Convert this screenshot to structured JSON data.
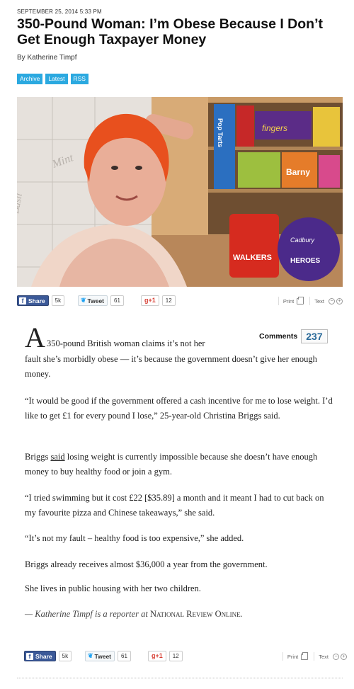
{
  "article": {
    "dateline": "SEPTEMBER 25, 2014 5:33 PM",
    "headline_line1": "350-Pound Woman: I’m Obese Because I Don’t",
    "headline_line2": "Get Enough Taxpayer Money",
    "byline": "By Katherine Timpf",
    "tags": [
      "Archive",
      "Latest",
      "RSS"
    ],
    "dropcap": "A",
    "p1_first_line": "350-pound British woman claims it’s not her",
    "p1_rest": "fault she’s morbidly obese — it’s because the government doesn’t give her enough money.",
    "p2": "“It would be good if the government offered a cash incentive for me to lose weight. I’d like to get £1  for every pound I lose,” 25-year-old Christina Briggs said.",
    "p3_link": "said",
    "p3_before": "Briggs ",
    "p3_after": " losing weight is currently impossible because she doesn’t have enough money to buy healthy food or join a gym.",
    "p4": "“I tried swimming but it cost £22 [$35.89] a month and it meant I had to cut back on my favourite pizza and Chinese takeaways,” she said.",
    "p5": "“It’s not my fault – healthy food is too expensive,” she added.",
    "p6": "Briggs already receives almost $36,000 a year from the government.",
    "p7": "She lives in public housing with her two children.",
    "signoff_prefix": "— Katherine Timpf is a reporter at ",
    "signoff_pub": "National Review Online",
    "signoff_end": "."
  },
  "photo": {
    "text_mint": "Mint",
    "text_basil": "Basil",
    "snack_labels": [
      "Pop Tarts",
      "fingers",
      "Barny",
      "WALKERS",
      "HEROES",
      "Cadbury"
    ]
  },
  "share_top": {
    "facebook_label": "Share",
    "facebook_count": "5k",
    "twitter_label": "Tweet",
    "twitter_count": "61",
    "gplus_label": "g+1",
    "gplus_count": "12",
    "print_label": "Print",
    "text_label": "Text"
  },
  "share_bottom": {
    "facebook_label": "Share",
    "facebook_count": "5k",
    "twitter_label": "Tweet",
    "twitter_count": "61",
    "gplus_label": "g+1",
    "gplus_count": "12",
    "print_label": "Print",
    "text_label": "Text"
  },
  "comments": {
    "label": "Comments",
    "count": "237"
  },
  "colors": {
    "tag_blue": "#2ba9e0",
    "facebook": "#3b5998",
    "comments_count": "#2b6b9a"
  }
}
